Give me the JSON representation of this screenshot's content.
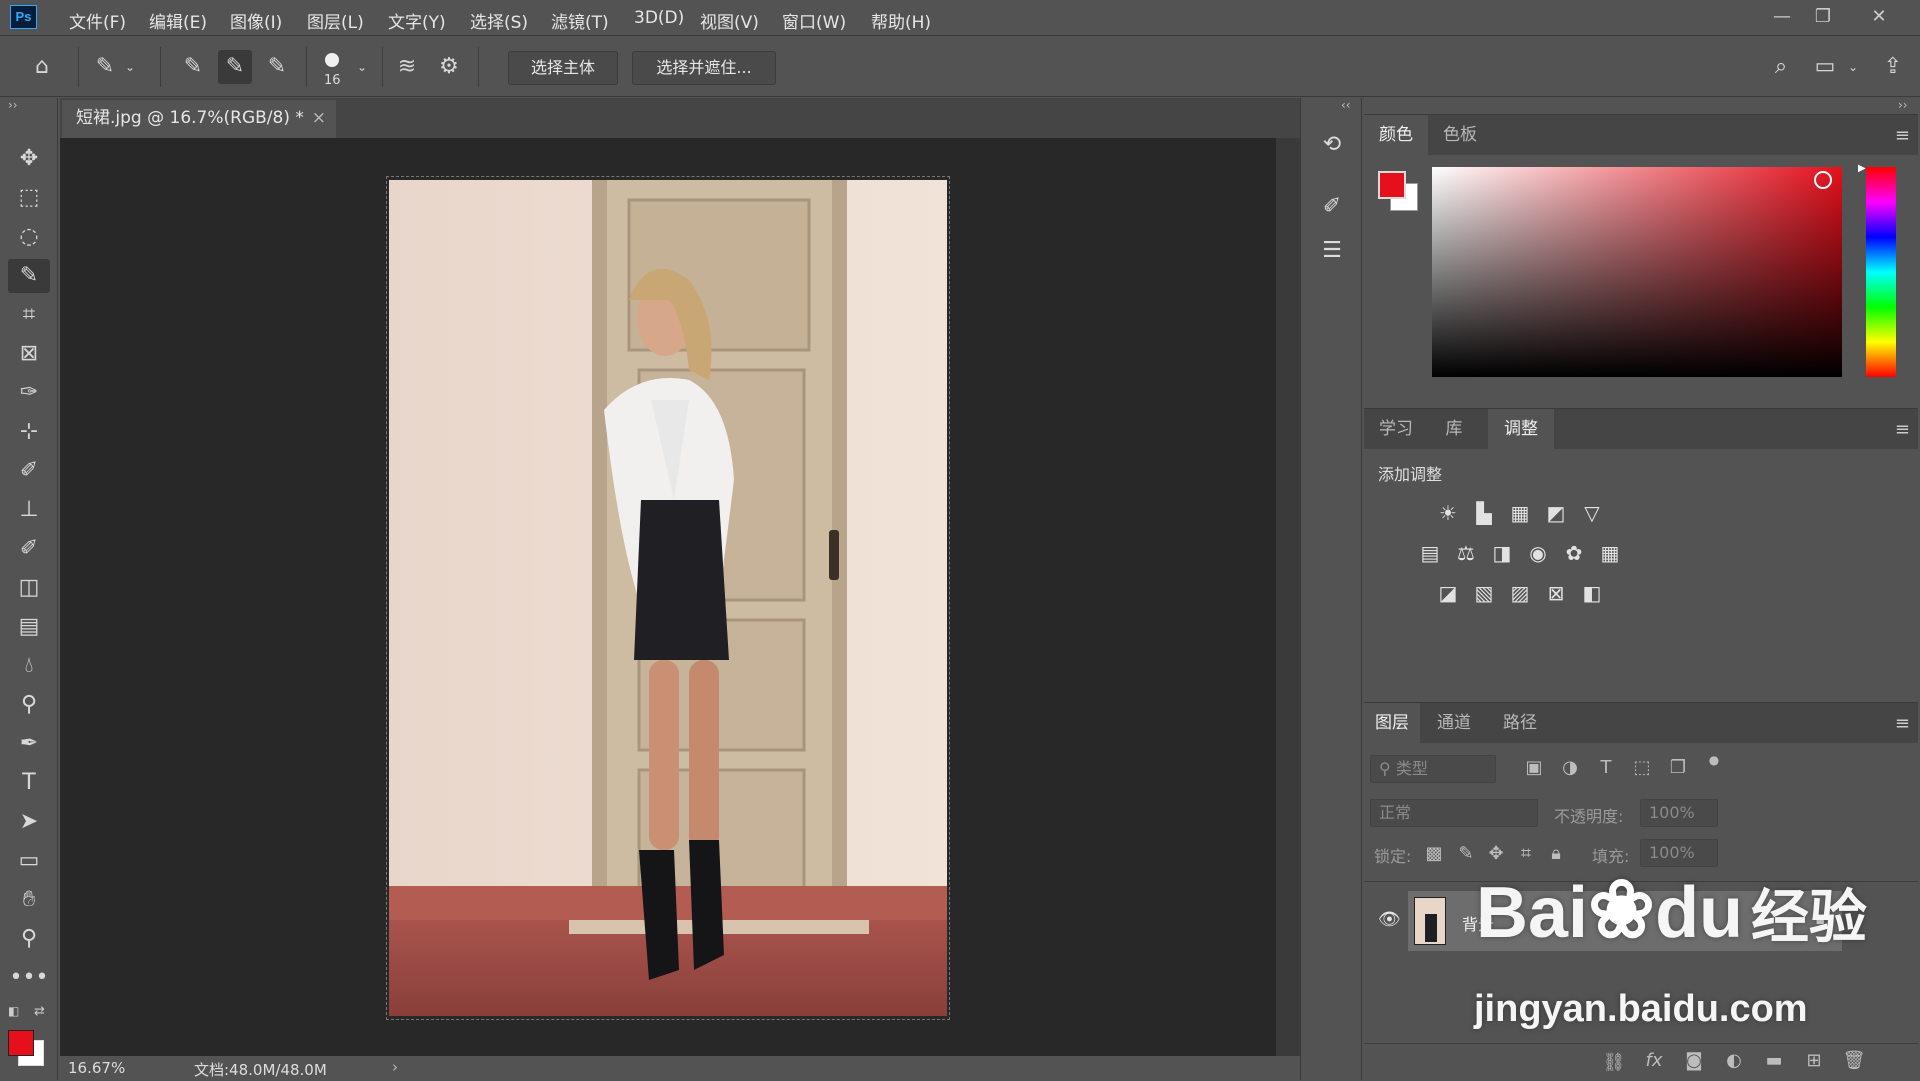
{
  "app": {
    "logo": "Ps"
  },
  "menu": [
    "文件(F)",
    "编辑(E)",
    "图像(I)",
    "图层(L)",
    "文字(Y)",
    "选择(S)",
    "滤镜(T)",
    "3D(D)",
    "视图(V)",
    "窗口(W)",
    "帮助(H)"
  ],
  "options": {
    "brush_size": "16",
    "select_subject": "选择主体",
    "select_and_mask": "选择并遮住..."
  },
  "document": {
    "tab_title": "短裙.jpg @ 16.7%(RGB/8) *",
    "close": "×",
    "zoom": "16.67%",
    "doc_size": "文档:48.0M/48.0M",
    "status_arrow": "›"
  },
  "color_panel": {
    "tabs": [
      "颜色",
      "色板"
    ],
    "fg_color": "#e5101c",
    "bg_color": "#ffffff"
  },
  "adjust_panel": {
    "tabs": [
      "学习",
      "库",
      "调整"
    ],
    "heading": "添加调整"
  },
  "layers_panel": {
    "tabs": [
      "图层",
      "通道",
      "路径"
    ],
    "filter_placeholder": "类型",
    "blend_mode": "正常",
    "opacity_label": "不透明度:",
    "opacity_value": "100%",
    "lock_label": "锁定:",
    "fill_label": "填充:",
    "fill_value": "100%",
    "layer_name": "背景"
  },
  "watermark": {
    "brand": "Bai",
    "brand2": "du",
    "cn": "经验",
    "url": "jingyan.baidu.com"
  }
}
